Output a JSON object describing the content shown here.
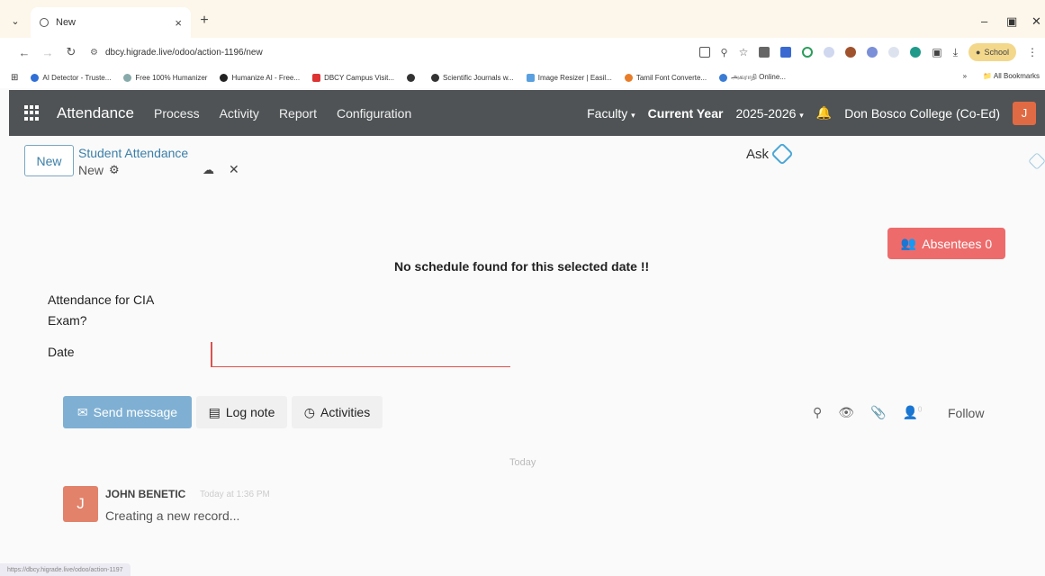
{
  "browser": {
    "tab_title": "New",
    "url": "dbcy.higrade.live/odoo/action-1196/new",
    "profile_label": "School",
    "bookmarks": [
      "AI Detector - Truste...",
      "Free 100% Humanizer",
      "Humanize AI - Free...",
      "DBCY Campus Visit...",
      "",
      "Scientific Journals w...",
      "Image Resizer | Easil...",
      "Tamil Font Converte...",
      "அகராதி Online..."
    ],
    "all_bookmarks": "All Bookmarks",
    "more_bookmarks": "»",
    "status_url": "https://dbcy.higrade.live/odoo/action-1197"
  },
  "navbar": {
    "app_name": "Attendance",
    "menu": [
      "Process",
      "Activity",
      "Report",
      "Configuration"
    ],
    "faculty": "Faculty",
    "current_year_label": "Current Year",
    "year": "2025-2026",
    "company": "Don Bosco College (Co-Ed)",
    "user_initial": "J"
  },
  "control_panel": {
    "new_button": "New",
    "breadcrumb_parent": "Student Attendance",
    "breadcrumb_current": "New",
    "ask_label": "Ask"
  },
  "form": {
    "absentees_label": "Absentees 0",
    "no_schedule_msg": "No schedule found for this selected date !!",
    "cia_label": "Attendance for CIA Exam?",
    "date_label": "Date",
    "date_value": ""
  },
  "chatter": {
    "send_message": "Send message",
    "log_note": "Log note",
    "activities": "Activities",
    "follow": "Follow",
    "follower_count": "0",
    "date_separator": "Today",
    "message": {
      "avatar_initial": "J",
      "author": "JOHN BENETIC",
      "time": "Today at 1:36 PM",
      "body": "Creating a new record..."
    }
  },
  "colors": {
    "navbar_bg": "#4f5355",
    "link_blue": "#3b7fa8",
    "absentees_red": "#ee6b6b",
    "send_blue": "#7fb0d3",
    "avatar_orange": "#e06a43"
  }
}
